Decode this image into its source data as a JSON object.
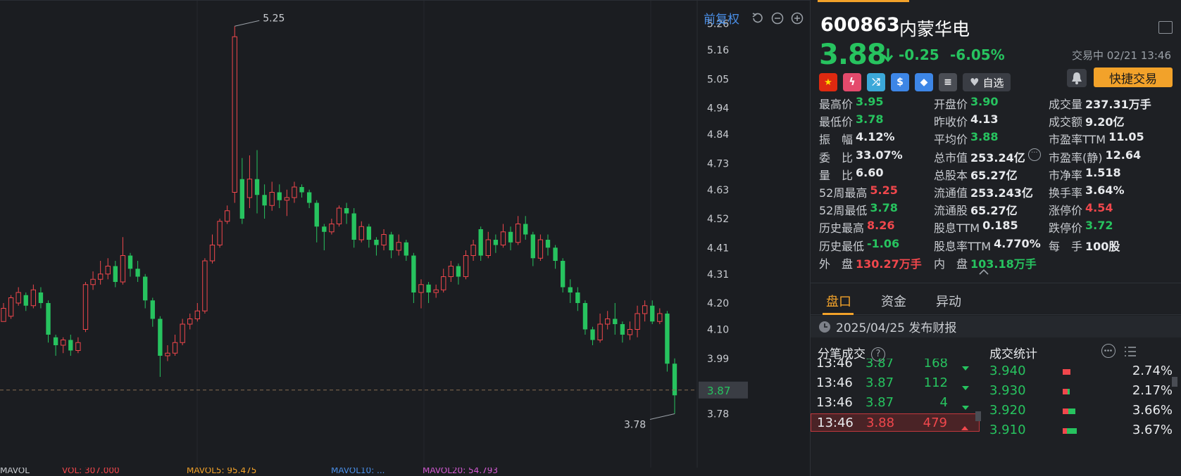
{
  "chart": {
    "fuquan": "前复权",
    "price_axis": [
      "5.26",
      "5.16",
      "5.05",
      "4.94",
      "4.84",
      "4.73",
      "4.63",
      "4.52",
      "4.41",
      "4.31",
      "4.20",
      "4.10",
      "3.99",
      "3.78"
    ],
    "current_label": "3.87",
    "high_mark": "5.25",
    "low_mark": "3.78",
    "indicators": [
      "MAVOL",
      "VOL: 307.000",
      "MAVOL5: 95.475",
      "MAVOL10: ...",
      "MAVOL20: 54.793"
    ],
    "colors": {
      "up": "#f0474c",
      "down": "#27c35f",
      "axis_text": "#c9ccd1",
      "dash": "#8a6e52"
    }
  },
  "chart_data": {
    "type": "candlestick",
    "y_range": [
      3.72,
      5.32
    ],
    "current_price": 3.87,
    "max_label": 5.25,
    "min_label": 3.78,
    "candles": [
      [
        4.13,
        4.18,
        4.15,
        4.2
      ],
      [
        4.15,
        4.22,
        4.14,
        4.23
      ],
      [
        4.2,
        4.24,
        4.19,
        4.26
      ],
      [
        4.23,
        4.19,
        4.17,
        4.24
      ],
      [
        4.19,
        4.25,
        4.18,
        4.27
      ],
      [
        4.24,
        4.2,
        4.18,
        4.26
      ],
      [
        4.2,
        4.08,
        4.05,
        4.21
      ],
      [
        4.07,
        4.04,
        4.0,
        4.08
      ],
      [
        4.04,
        4.06,
        4.01,
        4.07
      ],
      [
        4.06,
        4.02,
        4.0,
        4.08
      ],
      [
        4.02,
        4.05,
        4.01,
        4.07
      ],
      [
        4.1,
        4.27,
        4.09,
        4.28
      ],
      [
        4.27,
        4.29,
        4.25,
        4.32
      ],
      [
        4.29,
        4.31,
        4.27,
        4.36
      ],
      [
        4.31,
        4.34,
        4.29,
        4.37
      ],
      [
        4.34,
        4.28,
        4.26,
        4.36
      ],
      [
        4.28,
        4.38,
        4.27,
        4.45
      ],
      [
        4.38,
        4.33,
        4.3,
        4.39
      ],
      [
        4.33,
        4.3,
        4.28,
        4.36
      ],
      [
        4.3,
        4.21,
        4.18,
        4.31
      ],
      [
        4.21,
        4.14,
        4.11,
        4.22
      ],
      [
        4.14,
        4.0,
        3.92,
        4.15
      ],
      [
        4.0,
        4.01,
        3.98,
        4.04
      ],
      [
        4.01,
        4.05,
        4.0,
        4.08
      ],
      [
        4.05,
        4.12,
        4.04,
        4.14
      ],
      [
        4.12,
        4.14,
        4.1,
        4.16
      ],
      [
        4.14,
        4.17,
        4.13,
        4.2
      ],
      [
        4.17,
        4.36,
        4.16,
        4.37
      ],
      [
        4.36,
        4.42,
        4.35,
        4.46
      ],
      [
        4.42,
        4.51,
        4.41,
        4.52
      ],
      [
        4.51,
        4.55,
        4.5,
        4.57
      ],
      [
        4.62,
        5.21,
        4.58,
        5.25
      ],
      [
        4.67,
        4.52,
        4.5,
        4.75
      ],
      [
        4.6,
        4.67,
        4.56,
        4.76
      ],
      [
        4.67,
        4.61,
        4.54,
        4.78
      ],
      [
        4.61,
        4.57,
        4.52,
        4.65
      ],
      [
        4.57,
        4.62,
        4.55,
        4.66
      ],
      [
        4.62,
        4.59,
        4.56,
        4.65
      ],
      [
        4.59,
        4.6,
        4.53,
        4.63
      ],
      [
        4.6,
        4.64,
        4.58,
        4.66
      ],
      [
        4.64,
        4.62,
        4.6,
        4.65
      ],
      [
        4.62,
        4.58,
        4.56,
        4.63
      ],
      [
        4.58,
        4.49,
        4.43,
        4.59
      ],
      [
        4.49,
        4.47,
        4.4,
        4.5
      ],
      [
        4.47,
        4.5,
        4.46,
        4.52
      ],
      [
        4.5,
        4.56,
        4.49,
        4.57
      ],
      [
        4.56,
        4.54,
        4.5,
        4.58
      ],
      [
        4.54,
        4.44,
        4.41,
        4.56
      ],
      [
        4.44,
        4.49,
        4.43,
        4.51
      ],
      [
        4.49,
        4.44,
        4.41,
        4.5
      ],
      [
        4.44,
        4.42,
        4.38,
        4.45
      ],
      [
        4.42,
        4.46,
        4.4,
        4.48
      ],
      [
        4.46,
        4.4,
        4.37,
        4.47
      ],
      [
        4.4,
        4.43,
        4.38,
        4.46
      ],
      [
        4.43,
        4.38,
        4.36,
        4.44
      ],
      [
        4.38,
        4.24,
        4.2,
        4.39
      ],
      [
        4.24,
        4.27,
        4.18,
        4.29
      ],
      [
        4.27,
        4.24,
        4.2,
        4.28
      ],
      [
        4.24,
        4.25,
        4.22,
        4.27
      ],
      [
        4.25,
        4.3,
        4.24,
        4.33
      ],
      [
        4.3,
        4.34,
        4.28,
        4.36
      ],
      [
        4.34,
        4.3,
        4.27,
        4.35
      ],
      [
        4.3,
        4.38,
        4.29,
        4.4
      ],
      [
        4.38,
        4.42,
        4.36,
        4.44
      ],
      [
        4.48,
        4.38,
        4.36,
        4.49
      ],
      [
        4.38,
        4.44,
        4.37,
        4.47
      ],
      [
        4.44,
        4.42,
        4.39,
        4.46
      ],
      [
        4.42,
        4.47,
        4.41,
        4.5
      ],
      [
        4.47,
        4.43,
        4.4,
        4.49
      ],
      [
        4.43,
        4.5,
        4.42,
        4.53
      ],
      [
        4.5,
        4.46,
        4.44,
        4.53
      ],
      [
        4.46,
        4.37,
        4.34,
        4.47
      ],
      [
        4.37,
        4.44,
        4.36,
        4.46
      ],
      [
        4.44,
        4.41,
        4.38,
        4.46
      ],
      [
        4.41,
        4.36,
        4.33,
        4.42
      ],
      [
        4.36,
        4.26,
        4.24,
        4.37
      ],
      [
        4.26,
        4.24,
        4.2,
        4.29
      ],
      [
        4.24,
        4.2,
        4.17,
        4.26
      ],
      [
        4.2,
        4.1,
        4.08,
        4.21
      ],
      [
        4.1,
        4.06,
        4.04,
        4.11
      ],
      [
        4.06,
        4.12,
        4.05,
        4.16
      ],
      [
        4.12,
        4.14,
        4.1,
        4.17
      ],
      [
        4.14,
        4.12,
        4.08,
        4.2
      ],
      [
        4.12,
        4.08,
        4.05,
        4.13
      ],
      [
        4.08,
        4.1,
        4.06,
        4.13
      ],
      [
        4.1,
        4.16,
        4.07,
        4.19
      ],
      [
        4.16,
        4.19,
        4.13,
        4.21
      ],
      [
        4.19,
        4.13,
        4.12,
        4.21
      ],
      [
        4.13,
        4.16,
        4.12,
        4.18
      ],
      [
        4.16,
        3.97,
        3.94,
        4.17
      ],
      [
        3.97,
        3.85,
        3.78,
        3.99
      ]
    ]
  },
  "stock": {
    "code": "600863",
    "name": "内蒙华电",
    "price": "3.88",
    "change": "-0.25",
    "change_pct": "-6.05%",
    "time": "交易中 02/21 13:46",
    "watch_label": "自选",
    "quick_trade": "快捷交易",
    "tag_icons": [
      "cn-flag-icon",
      "lightning-icon",
      "shuffle-icon",
      "dollar-icon",
      "tag-icon",
      "doc-icon"
    ]
  },
  "stats": {
    "c1": [
      {
        "label": "最高价",
        "value": "3.95",
        "color": "g"
      },
      {
        "label": "最低价",
        "value": "3.78",
        "color": "g"
      },
      {
        "label": "振　幅",
        "value": "4.12%",
        "color": ""
      },
      {
        "label": "委　比",
        "value": "33.07%",
        "color": ""
      },
      {
        "label": "量　比",
        "value": "6.60",
        "color": ""
      },
      {
        "label": "52周最高",
        "value": "5.25",
        "color": "r"
      },
      {
        "label": "52周最低",
        "value": "3.78",
        "color": "g"
      },
      {
        "label": "历史最高",
        "value": "8.26",
        "color": "r"
      },
      {
        "label": "历史最低",
        "value": "-1.06",
        "color": "g"
      },
      {
        "label": "外　盘",
        "value": "130.27万手",
        "color": "r"
      }
    ],
    "c2": [
      {
        "label": "开盘价",
        "value": "3.90",
        "color": "g"
      },
      {
        "label": "昨收价",
        "value": "4.13",
        "color": ""
      },
      {
        "label": "平均价",
        "value": "3.88",
        "color": "g"
      },
      {
        "label": "总市值",
        "value": "253.24亿",
        "color": ""
      },
      {
        "label": "总股本",
        "value": "65.27亿",
        "color": ""
      },
      {
        "label": "流通值",
        "value": "253.243亿",
        "color": ""
      },
      {
        "label": "流通股",
        "value": "65.27亿",
        "color": ""
      },
      {
        "label": "股息TTM",
        "value": "0.185",
        "color": ""
      },
      {
        "label": "股息率TTM",
        "value": "4.770%",
        "color": ""
      },
      {
        "label": "内　盘",
        "value": "103.18万手",
        "color": "g"
      }
    ],
    "c3": [
      {
        "label": "成交量",
        "value": "237.31万手",
        "color": ""
      },
      {
        "label": "成交额",
        "value": "9.20亿",
        "color": ""
      },
      {
        "label": "市盈率TTM",
        "value": "11.05",
        "color": ""
      },
      {
        "label": "市盈率(静)",
        "value": "12.64",
        "color": ""
      },
      {
        "label": "市净率",
        "value": "1.518",
        "color": ""
      },
      {
        "label": "换手率",
        "value": "3.64%",
        "color": ""
      },
      {
        "label": "涨停价",
        "value": "4.54",
        "color": "r"
      },
      {
        "label": "跌停价",
        "value": "3.72",
        "color": "g"
      },
      {
        "label": "每　手",
        "value": "100股",
        "color": ""
      }
    ]
  },
  "tabs": [
    "盘口",
    "资金",
    "异动"
  ],
  "report": "2025/04/25  发布财报",
  "ticks_title": "分笔成交",
  "vstats_title": "成交统计",
  "ticks": [
    {
      "time": "13:46",
      "price": "3.87",
      "vol": "168",
      "dir": "down"
    },
    {
      "time": "13:46",
      "price": "3.87",
      "vol": "112",
      "dir": "down"
    },
    {
      "time": "13:46",
      "price": "3.87",
      "vol": "4",
      "dir": "down"
    },
    {
      "time": "13:46",
      "price": "3.88",
      "vol": "479",
      "dir": "up"
    }
  ],
  "vstats": [
    {
      "price": "3.940",
      "pct": "2.74%",
      "red": 0.8,
      "green": 0.0
    },
    {
      "price": "3.930",
      "pct": "2.17%",
      "red": 0.5,
      "green": 0.2
    },
    {
      "price": "3.920",
      "pct": "3.66%",
      "red": 0.6,
      "green": 0.7
    },
    {
      "price": "3.910",
      "pct": "3.67%",
      "red": 0.4,
      "green": 1.0
    }
  ]
}
